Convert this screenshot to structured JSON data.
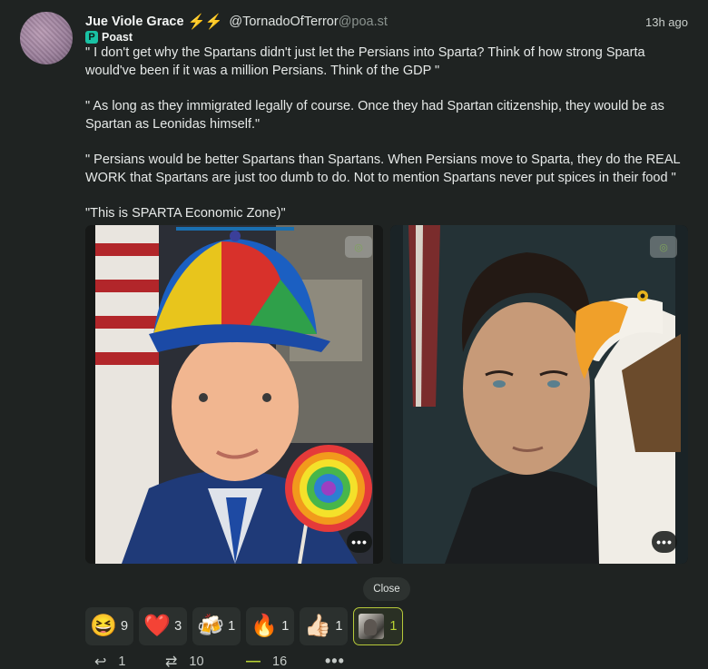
{
  "post": {
    "author_name": "Jue Viole Grace",
    "author_badge": "⚡⚡",
    "handle": "@TornadoOfTerror",
    "domain": "@poa.st",
    "timestamp": "13h ago",
    "app_name": "Poast",
    "app_icon": "P",
    "paragraphs": [
      "\" I don't get why the Spartans didn't just let the Persians into Sparta? Think of how strong Sparta would've been if it was a million Persians. Think of the GDP \"",
      "\" As long as they immigrated legally of course. Once they had Spartan citizenship, they would be as Spartan as Leonidas himself.\"",
      "\" Persians would be better Spartans than Spartans. When Persians move to Sparta, they do the REAL WORK that Spartans are just too dumb to do. Not to mention Spartans never put spices in their food \"",
      "\"This is SPARTA Economic Zone)\""
    ]
  },
  "media": [
    {
      "description": "man-with-propeller-cap-and-lollipop-image",
      "hide_icon": "eye-slash-icon",
      "more_label": "•••"
    },
    {
      "description": "man-with-bald-eagle-image",
      "hide_icon": "eye-slash-icon",
      "more_label": "•••"
    }
  ],
  "close_label": "Close",
  "reactions": [
    {
      "emoji": "😆",
      "icon": "laughing-emoji",
      "count": "9"
    },
    {
      "emoji": "❤️",
      "icon": "heart-emoji",
      "count": "3"
    },
    {
      "emoji": "🍻",
      "icon": "beers-emoji",
      "count": "1"
    },
    {
      "emoji": "🔥",
      "icon": "fire-emoji",
      "count": "1"
    },
    {
      "emoji": "👍🏻",
      "icon": "thumbs-up-emoji",
      "count": "1"
    },
    {
      "emoji": "",
      "icon": "custom-image-emoji",
      "count": "1",
      "active": true
    }
  ],
  "actions": {
    "reply": {
      "icon": "↩",
      "count": "1"
    },
    "boost": {
      "icon": "⇄",
      "count": "10"
    },
    "react": {
      "icon": "—",
      "count": "16"
    },
    "more": {
      "icon": "•••"
    }
  },
  "colors": {
    "background": "#1f2322",
    "accent": "#b8d233",
    "app_icon": "#19c2a4"
  }
}
